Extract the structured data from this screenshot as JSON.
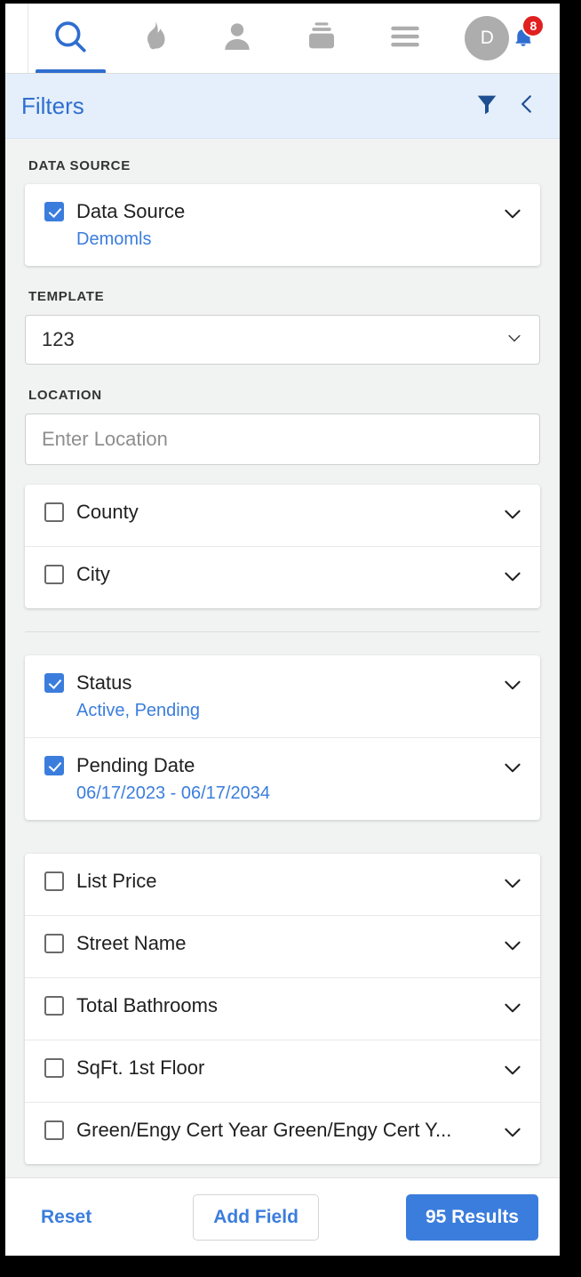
{
  "topnav": {
    "items": [
      {
        "icon": "search-icon",
        "name": "nav-search",
        "active": true
      },
      {
        "icon": "flame-icon",
        "name": "nav-hotsheet",
        "active": false
      },
      {
        "icon": "person-icon",
        "name": "nav-contacts",
        "active": false
      },
      {
        "icon": "cards-stack-icon",
        "name": "nav-cards",
        "active": false
      },
      {
        "icon": "hamburger-menu-icon",
        "name": "nav-menu",
        "active": false
      }
    ],
    "avatar_initial": "D",
    "notification_count": "8"
  },
  "header": {
    "title": "Filters",
    "filter_icon": "funnel-icon",
    "collapse_icon": "chevron-left-icon"
  },
  "sections": {
    "data_source": {
      "label": "DATA SOURCE",
      "row": {
        "label": "Data Source",
        "value": "Demomls",
        "checked": true
      }
    },
    "template": {
      "label": "TEMPLATE",
      "selected": "123"
    },
    "location": {
      "label": "LOCATION",
      "placeholder": "Enter Location",
      "value": "",
      "rows": [
        {
          "label": "County",
          "checked": false
        },
        {
          "label": "City",
          "checked": false
        }
      ]
    },
    "status_group": {
      "rows": [
        {
          "label": "Status",
          "value": "Active, Pending",
          "checked": true
        },
        {
          "label": "Pending Date",
          "value": "06/17/2023 - 06/17/2034",
          "checked": true
        }
      ]
    },
    "fields_group": {
      "rows": [
        {
          "label": "List Price",
          "checked": false
        },
        {
          "label": "Street Name",
          "checked": false
        },
        {
          "label": "Total Bathrooms",
          "checked": false
        },
        {
          "label": "SqFt. 1st Floor",
          "checked": false
        },
        {
          "label": "Green/Engy Cert Year Green/Engy Cert Y...",
          "checked": false
        }
      ]
    }
  },
  "footer": {
    "reset_label": "Reset",
    "add_field_label": "Add Field",
    "results_label": "95 Results"
  },
  "colors": {
    "accent_blue": "#3b7ddd",
    "header_blue_bg": "#e4effb",
    "header_title_blue": "#2f6ed0",
    "badge_red": "#e02020",
    "page_bg": "#f1f2f2",
    "icon_gray": "#adadad"
  }
}
